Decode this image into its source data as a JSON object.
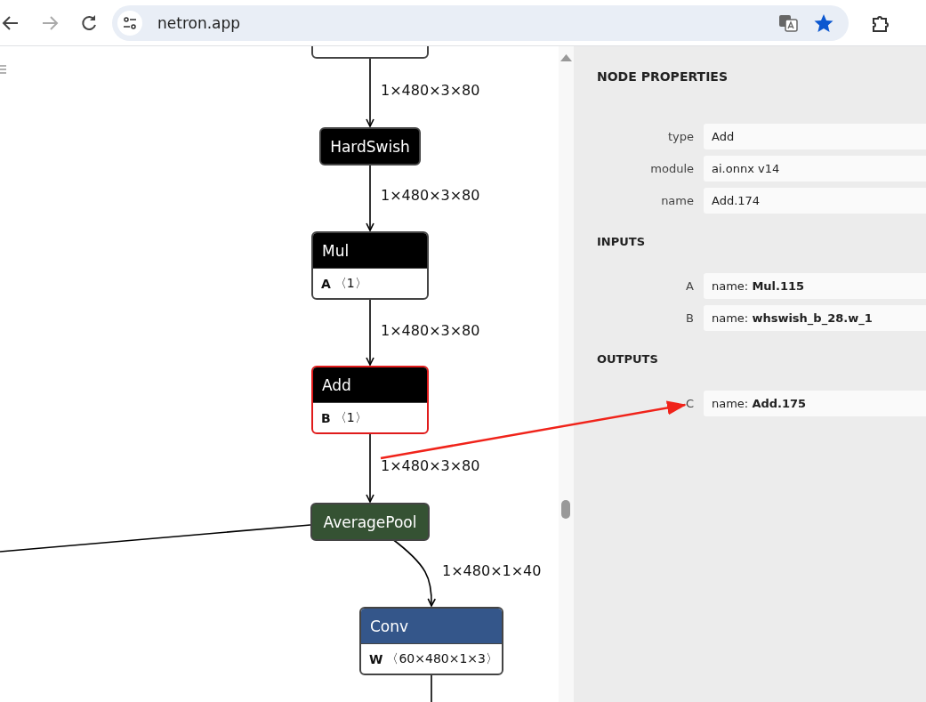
{
  "browser": {
    "url": "netron.app"
  },
  "graph": {
    "nodes": [
      {
        "kind": "cut",
        "selected": false
      },
      {
        "kind": "plain",
        "title": "HardSwish",
        "color": "#000000",
        "selected": false
      },
      {
        "kind": "attr",
        "title": "Mul",
        "color": "#000000",
        "attr_name": "A",
        "attr_value": "〈1〉",
        "selected": false
      },
      {
        "kind": "attr",
        "title": "Add",
        "color": "#000000",
        "attr_name": "B",
        "attr_value": "〈1〉",
        "selected": true
      },
      {
        "kind": "plain",
        "title": "AveragePool",
        "color": "#355233",
        "selected": false
      },
      {
        "kind": "attr",
        "title": "Conv",
        "color": "#34568a",
        "attr_name": "W",
        "attr_value": "〈60×480×1×3〉",
        "selected": false
      }
    ],
    "edge_labels": [
      "1×480×3×80",
      "1×480×3×80",
      "1×480×3×80",
      "1×480×3×80",
      "1×480×1×40"
    ]
  },
  "panel": {
    "title": "NODE PROPERTIES",
    "properties": [
      {
        "label": "type",
        "value": "Add"
      },
      {
        "label": "module",
        "value": "ai.onnx v14"
      },
      {
        "label": "name",
        "value": "Add.174"
      }
    ],
    "sections": [
      {
        "title": "INPUTS",
        "items": [
          {
            "label": "A",
            "value": "name: **Mul.115**"
          },
          {
            "label": "B",
            "value": "name: **whswish_b_28.w_1**"
          }
        ]
      },
      {
        "title": "OUTPUTS",
        "items": [
          {
            "label": "C",
            "value": "name: **Add.175**"
          }
        ]
      }
    ]
  }
}
